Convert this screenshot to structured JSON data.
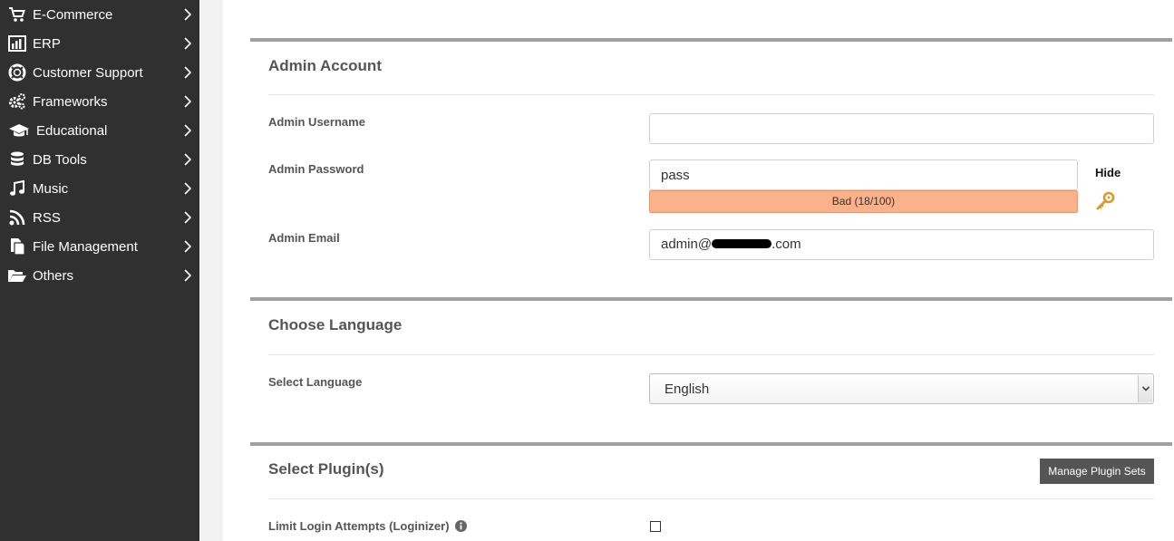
{
  "sidebar": {
    "items": [
      {
        "label": "E-Commerce",
        "icon": "cart-icon"
      },
      {
        "label": "ERP",
        "icon": "bar-chart-icon"
      },
      {
        "label": "Customer Support",
        "icon": "lifebuoy-icon"
      },
      {
        "label": "Frameworks",
        "icon": "gears-icon"
      },
      {
        "label": "Educational",
        "icon": "graduation-cap-icon"
      },
      {
        "label": "DB Tools",
        "icon": "database-icon"
      },
      {
        "label": "Music",
        "icon": "music-note-icon"
      },
      {
        "label": "RSS",
        "icon": "rss-icon"
      },
      {
        "label": "File Management",
        "icon": "files-icon"
      },
      {
        "label": "Others",
        "icon": "folder-open-icon"
      }
    ]
  },
  "admin_account": {
    "title": "Admin Account",
    "username_label": "Admin Username",
    "username_value": "",
    "password_label": "Admin Password",
    "password_value": "pass",
    "strength_text": "Bad (18/100)",
    "strength_color": "#fbb28a",
    "hide_label": "Hide",
    "email_label": "Admin Email",
    "email_prefix": "admin@",
    "email_suffix": ".com"
  },
  "language": {
    "title": "Choose Language",
    "select_label": "Select Language",
    "selected": "English"
  },
  "plugins": {
    "title": "Select Plugin(s)",
    "manage_button": "Manage Plugin Sets",
    "limit_login_label": "Limit Login Attempts (Loginizer)",
    "limit_login_checked": false
  },
  "colors": {
    "sidebar_bg": "#303030",
    "section_bar": "#a0a0a0",
    "button_bg": "#555555"
  }
}
